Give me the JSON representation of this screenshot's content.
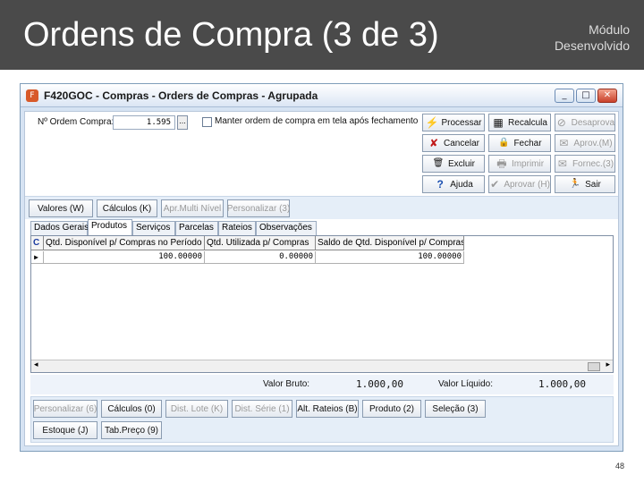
{
  "slide": {
    "title": "Ordens de Compra (3 de 3)",
    "module_line1": "Módulo",
    "module_line2": "Desenvolvido",
    "page_number": "48"
  },
  "window": {
    "title": "F420GOC - Compras - Orders de Compras - Agrupada",
    "icon_text": "F",
    "min": "_",
    "max": "□",
    "close": "✕"
  },
  "form": {
    "order_label": "Nº Ordem Compra:",
    "order_value": "1.595",
    "lookup_button": "...",
    "keep_checkbox_label": "Manter ordem de compra em tela após fechamento"
  },
  "actions": [
    {
      "label": "Processar",
      "icon": "⚡",
      "enabled": true
    },
    {
      "label": "Recalcula",
      "icon": "▦",
      "enabled": true
    },
    {
      "label": "Desaprova",
      "icon": "⊘",
      "enabled": false
    },
    {
      "label": "Cancelar",
      "icon": "✘",
      "enabled": true
    },
    {
      "label": "Fechar",
      "icon": "🔒",
      "enabled": true
    },
    {
      "label": "Aprov.(M)",
      "icon": "✉",
      "enabled": false
    },
    {
      "label": "Excluir",
      "icon": "🗑",
      "enabled": true
    },
    {
      "label": "Imprimir",
      "icon": "🖶",
      "enabled": false
    },
    {
      "label": "Fornec.(3)",
      "icon": "✉",
      "enabled": false
    },
    {
      "label": "Ajuda",
      "icon": "?",
      "enabled": true
    },
    {
      "label": "Aprovar (H)",
      "icon": "✔",
      "enabled": false
    },
    {
      "label": "Sair",
      "icon": "🏃",
      "enabled": true
    }
  ],
  "top_buttons": [
    {
      "label": "Valores (W)",
      "enabled": true
    },
    {
      "label": "Cálculos (K)",
      "enabled": true
    },
    {
      "label": "Apr.Multi Nível",
      "enabled": false
    },
    {
      "label": "Personalizar (3)",
      "enabled": false
    }
  ],
  "tabs": [
    "Dados Gerais",
    "Produtos",
    "Serviços",
    "Parcelas",
    "Rateios",
    "Observações"
  ],
  "active_tab": "Produtos",
  "grid": {
    "corner": "C",
    "columns": [
      "Qtd. Disponível p/ Compras no Período",
      "Qtd. Utilizada p/ Compras",
      "Saldo de Qtd. Disponível p/ Compras"
    ],
    "row_marker": "▶",
    "rows": [
      [
        "100.00000",
        "0.00000",
        "100.00000"
      ]
    ],
    "scroll_left": "◂",
    "scroll_right": "▸"
  },
  "totals": {
    "gross_label": "Valor Bruto:",
    "gross_value": "1.000,00",
    "net_label": "Valor Líquido:",
    "net_value": "1.000,00"
  },
  "bottom_buttons_row1": [
    {
      "label": "Personalizar (6)",
      "enabled": false
    },
    {
      "label": "Cálculos (0)",
      "enabled": true
    },
    {
      "label": "Dist. Lote (K)",
      "enabled": false
    },
    {
      "label": "Dist. Série (1)",
      "enabled": false
    },
    {
      "label": "Alt. Rateios (B)",
      "enabled": true
    },
    {
      "label": "Produto (2)",
      "enabled": true
    },
    {
      "label": "Seleção (3)",
      "enabled": true
    }
  ],
  "bottom_buttons_row2": [
    {
      "label": "Estoque (J)",
      "enabled": true
    },
    {
      "label": "Tab.Preço (9)",
      "enabled": true
    }
  ]
}
